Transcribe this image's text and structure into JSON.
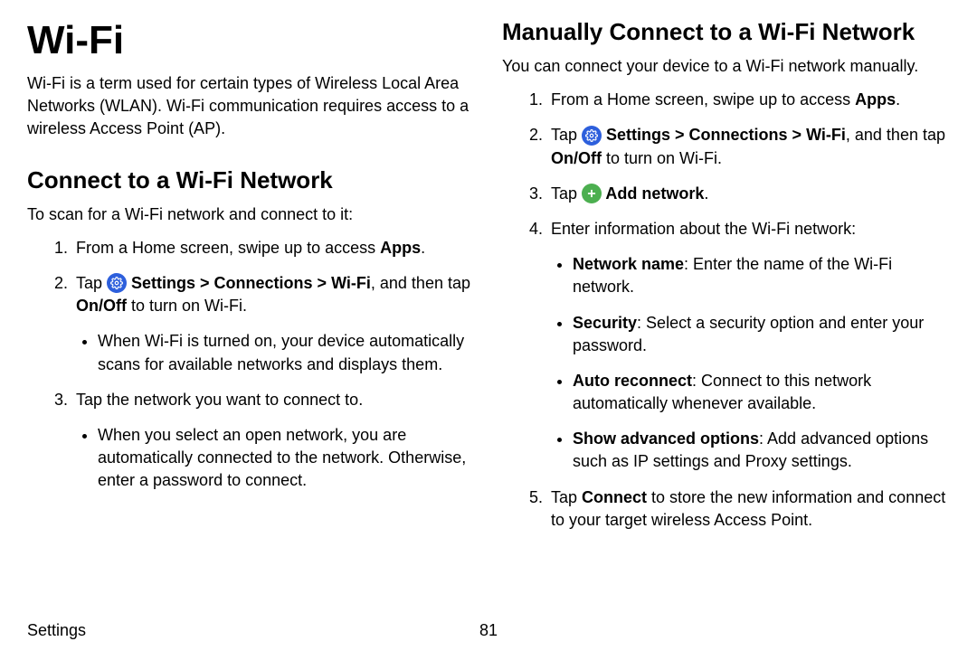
{
  "title": "Wi-Fi",
  "intro": "Wi-Fi is a term used for certain types of Wireless Local Area Networks (WLAN). Wi-Fi communication requires access to a wireless Access Point (AP).",
  "sectionA": {
    "heading": "Connect to a Wi-Fi Network",
    "lead": "To scan for a Wi-Fi network and connect to it:",
    "step1a": "From a Home screen, swipe up to access ",
    "step1b": "Apps",
    "step1c": ".",
    "step2a": "Tap ",
    "step2b": " Settings > Connections > Wi-Fi",
    "step2c": ", and then tap ",
    "step2d": "On/Off",
    "step2e": " to turn on Wi-Fi.",
    "step2bullet": "When Wi-Fi is turned on, your device automatically scans for available networks and displays them.",
    "step3": "Tap the network you want to connect to.",
    "step3bullet": "When you select an open network, you are automatically connected to the network. Otherwise, enter a password to connect."
  },
  "sectionB": {
    "heading": "Manually Connect to a Wi-Fi Network",
    "lead": "You can connect your device to a Wi-Fi network manually.",
    "step1a": "From a Home screen, swipe up to access ",
    "step1b": "Apps",
    "step1c": ".",
    "step2a": "Tap ",
    "step2b": " Settings > Connections > Wi-Fi",
    "step2c": ", and then tap ",
    "step2d": "On/Off",
    "step2e": " to turn on Wi-Fi.",
    "step3a": "Tap ",
    "step3b": " Add network",
    "step3c": ".",
    "step4": "Enter information about the Wi-Fi network:",
    "b1a": "Network name",
    "b1b": ": Enter the name of the Wi-Fi network.",
    "b2a": "Security",
    "b2b": ": Select a security option and enter your password.",
    "b3a": "Auto reconnect",
    "b3b": ": Connect to this network automatically whenever available.",
    "b4a": "Show advanced options",
    "b4b": ": Add advanced options such as IP settings and Proxy settings.",
    "step5a": "Tap ",
    "step5b": "Connect",
    "step5c": " to store the new information and connect to your target wireless Access Point."
  },
  "footer": {
    "section": "Settings",
    "page": "81"
  }
}
